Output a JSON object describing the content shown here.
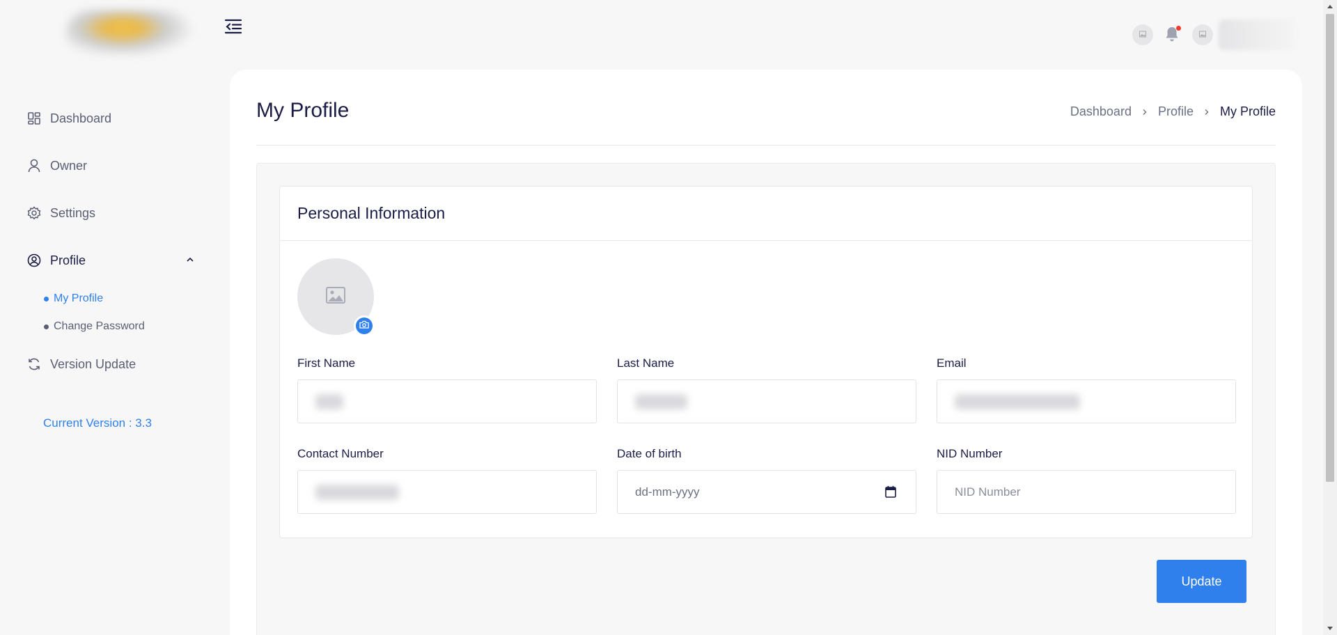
{
  "sidebar": {
    "items": [
      {
        "label": "Dashboard",
        "icon": "dashboard-icon"
      },
      {
        "label": "Owner",
        "icon": "user-icon"
      },
      {
        "label": "Settings",
        "icon": "gear-icon"
      },
      {
        "label": "Profile",
        "icon": "user-circle-icon",
        "expanded": true
      },
      {
        "label": "Version Update",
        "icon": "refresh-icon"
      }
    ],
    "profile_subitems": [
      {
        "label": "My Profile",
        "active": true
      },
      {
        "label": "Change Password",
        "active": false
      }
    ],
    "version_text": "Current Version : 3.3"
  },
  "header": {
    "notification_badge": true
  },
  "page": {
    "title": "My Profile",
    "breadcrumb": [
      "Dashboard",
      "Profile",
      "My Profile"
    ]
  },
  "form": {
    "section_title": "Personal Information",
    "fields": {
      "first_name": {
        "label": "First Name"
      },
      "last_name": {
        "label": "Last Name"
      },
      "email": {
        "label": "Email"
      },
      "contact_number": {
        "label": "Contact Number"
      },
      "date_of_birth": {
        "label": "Date of birth",
        "placeholder": "dd-mm-yyyy"
      },
      "nid_number": {
        "label": "NID Number",
        "placeholder": "NID Number"
      }
    },
    "submit_label": "Update"
  },
  "colors": {
    "accent": "#2f80ed",
    "text_primary": "#1a1c46",
    "text_secondary": "#5a5e73",
    "badge": "#f5372d",
    "background": "#f7f7f8"
  }
}
